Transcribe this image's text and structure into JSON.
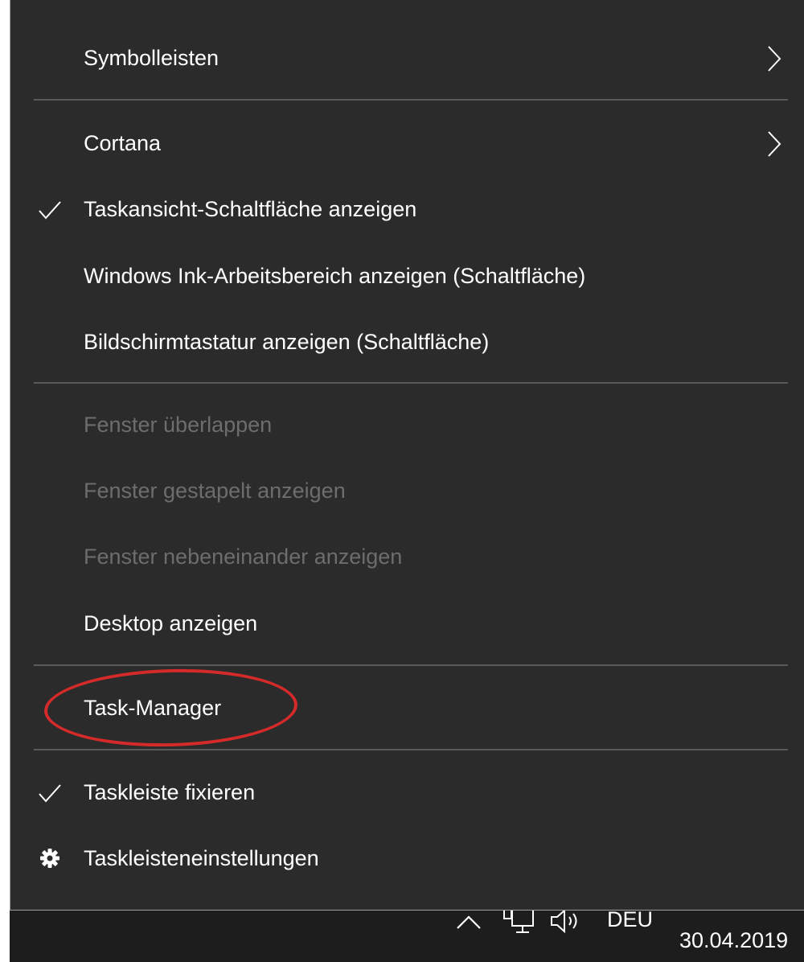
{
  "context_menu": {
    "items": [
      {
        "label": "Symbolleisten",
        "submenu": true,
        "checked": false,
        "enabled": true
      },
      {
        "label": "Cortana",
        "submenu": true,
        "checked": false,
        "enabled": true
      },
      {
        "label": "Taskansicht-Schaltfläche anzeigen",
        "checked": true,
        "enabled": true
      },
      {
        "label": "Windows Ink-Arbeitsbereich anzeigen (Schaltfläche)",
        "checked": false,
        "enabled": true
      },
      {
        "label": "Bildschirmtastatur anzeigen (Schaltfläche)",
        "checked": false,
        "enabled": true
      },
      {
        "label": "Fenster überlappen",
        "checked": false,
        "enabled": false
      },
      {
        "label": "Fenster gestapelt anzeigen",
        "checked": false,
        "enabled": false
      },
      {
        "label": "Fenster nebeneinander anzeigen",
        "checked": false,
        "enabled": false
      },
      {
        "label": "Desktop anzeigen",
        "checked": false,
        "enabled": true
      },
      {
        "label": "Task-Manager",
        "checked": false,
        "enabled": true,
        "highlighted": true
      },
      {
        "label": "Taskleiste fixieren",
        "checked": true,
        "enabled": true
      },
      {
        "label": "Taskleisteneinstellungen",
        "icon": "gear-icon",
        "enabled": true
      }
    ]
  },
  "taskbar": {
    "tray_icons": [
      "chevron-up-icon",
      "network-icon",
      "volume-icon"
    ],
    "language": "DEU",
    "date": "30.04.2019"
  },
  "colors": {
    "menu_background": "#2b2b2b",
    "taskbar_background": "#1d1d1d",
    "separator": "#5a5a5a",
    "text": "#ffffff",
    "disabled_text": "#6d6d6d",
    "highlight_annotation": "#d42a2a"
  }
}
